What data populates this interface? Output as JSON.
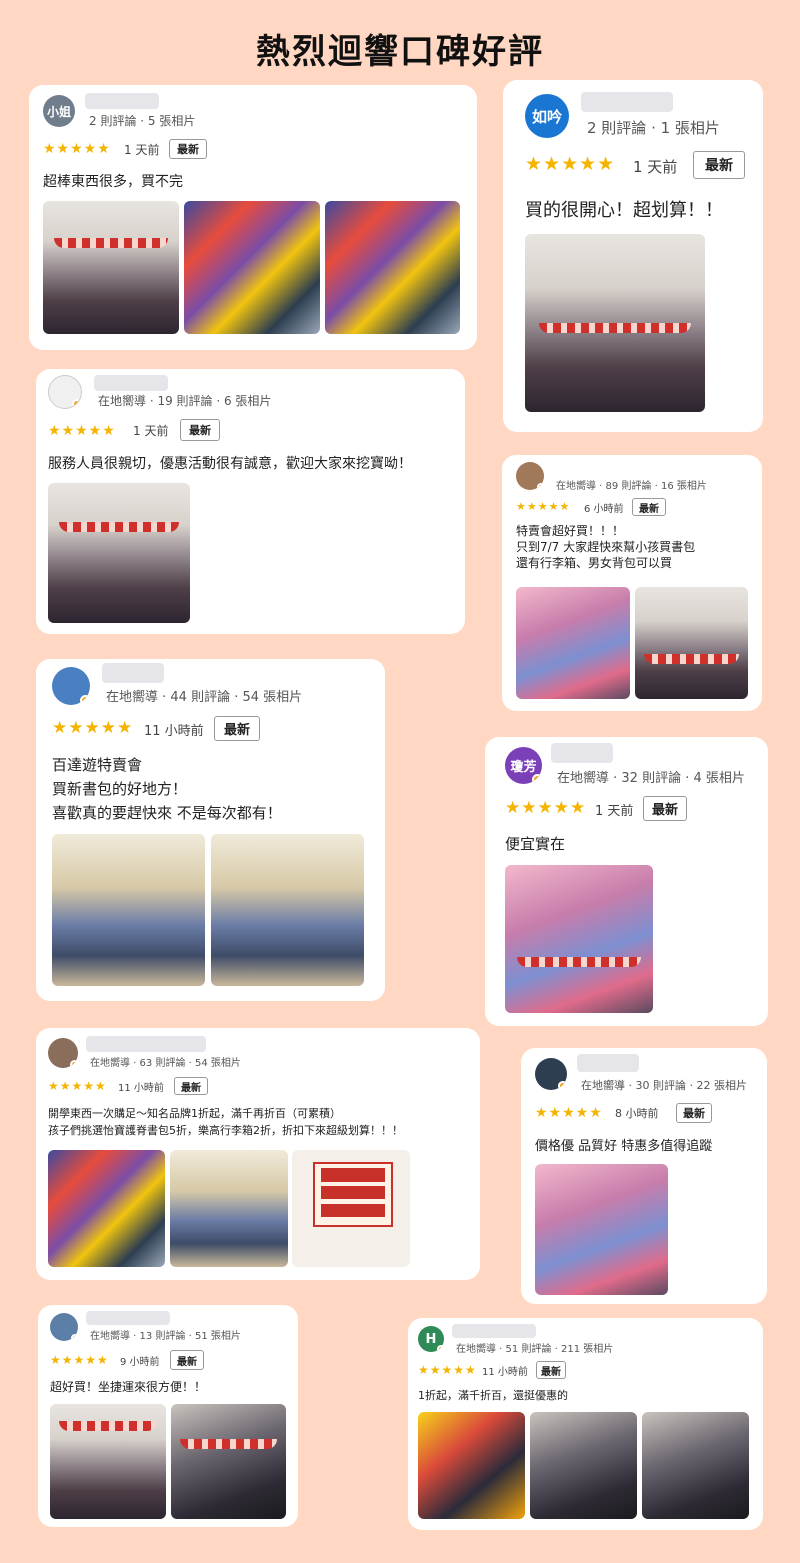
{
  "page_title": "熱烈迴響口碑好評",
  "new_tag": "最新",
  "stars": "★★★★★",
  "reviews": [
    {
      "avatar_text": "小姐",
      "avatar_color": "#6f7d8c",
      "meta": "2 則評論 · 5 張相片",
      "time": "1 天前",
      "text": "超棒東西很多，買不完"
    },
    {
      "avatar_text": "如吟",
      "avatar_color": "#1976d2",
      "meta": "2 則評論 · 1 張相片",
      "time": "1 天前",
      "text": "買的很開心！超划算！！"
    },
    {
      "avatar_text": "",
      "avatar_color": "#f0f0f0",
      "meta": "在地嚮導 · 19 則評論 · 6 張相片",
      "time": "1 天前",
      "text": "服務人員很親切，優惠活動很有誠意，歡迎大家來挖寶呦！"
    },
    {
      "avatar_text": "",
      "avatar_color": "#a0785a",
      "meta": "在地嚮導 · 89 則評論 · 16 張相片",
      "time": "6 小時前",
      "text": "特賣會超好買！！！\n只到7/7 大家趕快來幫小孩買書包\n還有行李箱、男女背包可以買"
    },
    {
      "avatar_text": "",
      "avatar_color": "#4a7fc1",
      "meta": "在地嚮導 · 44 則評論 · 54 張相片",
      "time": "11 小時前",
      "text": "百達遊特賣會\n買新書包的好地方！\n喜歡真的要趕快來 不是每次都有！"
    },
    {
      "avatar_text": "瓊芳",
      "avatar_color": "#7b3fb8",
      "meta": "在地嚮導 · 32 則評論 · 4 張相片",
      "time": "1 天前",
      "text": "便宜實在"
    },
    {
      "avatar_text": "",
      "avatar_color": "#8a6d5a",
      "meta": "在地嚮導 · 63 則評論 · 54 張相片",
      "time": "11 小時前",
      "text": "開學東西一次購足～知名品牌1折起，滿千再折百（可累積）\n孩子們挑選怡寶護脊書包5折，樂高行李箱2折，折扣下來超級划算！！！"
    },
    {
      "avatar_text": "",
      "avatar_color": "#2c3e50",
      "meta": "在地嚮導 · 30 則評論 · 22 張相片",
      "time": "8 小時前",
      "text": "價格優 品質好 特惠多值得追蹤"
    },
    {
      "avatar_text": "",
      "avatar_color": "#5b7fa6",
      "meta": "在地嚮導 · 13 則評論 · 51 張相片",
      "time": "9 小時前",
      "text": "超好買！坐捷運來很方便！！"
    },
    {
      "avatar_text": "H",
      "avatar_color": "#2e8b57",
      "meta": "在地嚮導 · 51 則評論 · 211 張相片",
      "time": "11 小時前",
      "text": "1折起，滿千折百，還挺優惠的"
    }
  ]
}
